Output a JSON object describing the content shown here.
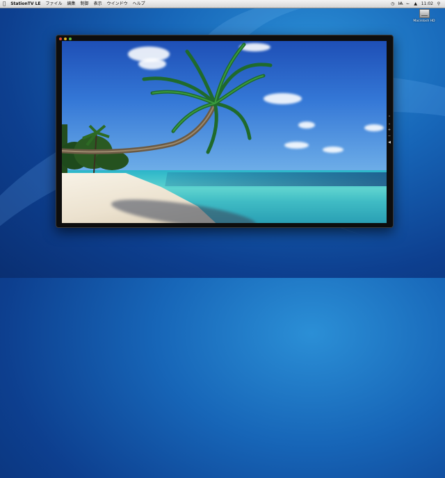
{
  "menubar": {
    "app_name": "StationTV LE",
    "menus": [
      "ファイル",
      "編集",
      "制御",
      "表示",
      "ウインドウ",
      "ヘルプ"
    ],
    "status_icons": [
      "clock-icon",
      "bluetooth-icon",
      "wifi-icon",
      "volume-icon"
    ],
    "clock": "11:02",
    "spotlight_icon": "search-icon"
  },
  "desktop": {
    "drive_label": "Macintosh HD"
  },
  "player": {
    "side_controls": [
      "channel-up-icon",
      "channel-down-icon",
      "volume-up-icon",
      "volume-down-icon",
      "mute-icon"
    ]
  }
}
